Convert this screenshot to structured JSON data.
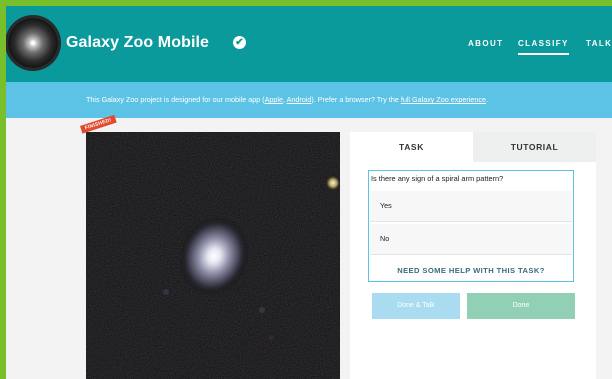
{
  "header": {
    "title": "Galaxy Zoo Mobile",
    "nav": [
      "ABOUT",
      "CLASSIFY",
      "TALK"
    ],
    "active_nav": "CLASSIFY",
    "colors": {
      "header_bg": "#0a9a9c",
      "banner_bg": "#5cc3e6",
      "border": "#78bf2c"
    }
  },
  "banner": {
    "text_before": "This Galaxy Zoo project is designed for our mobile app (",
    "link_apple": "Apple",
    "separator": ", ",
    "link_android": "Android",
    "text_middle": "). Prefer a browser? Try the ",
    "link_full": "full Galaxy Zoo experience",
    "text_after": "."
  },
  "subject": {
    "badge": "FINISHED!"
  },
  "panel": {
    "tabs": [
      "TASK",
      "TUTORIAL"
    ],
    "active_tab": "TASK",
    "question": "Is there any sign of a spiral arm pattern?",
    "answers": [
      "Yes",
      "No"
    ],
    "help": "NEED SOME HELP WITH THIS TASK?",
    "buttons": {
      "done_talk": "Done & Talk",
      "done": "Done"
    }
  },
  "icons": {
    "verified": "check-circle-icon",
    "logo": "galaxy-logo-icon"
  }
}
